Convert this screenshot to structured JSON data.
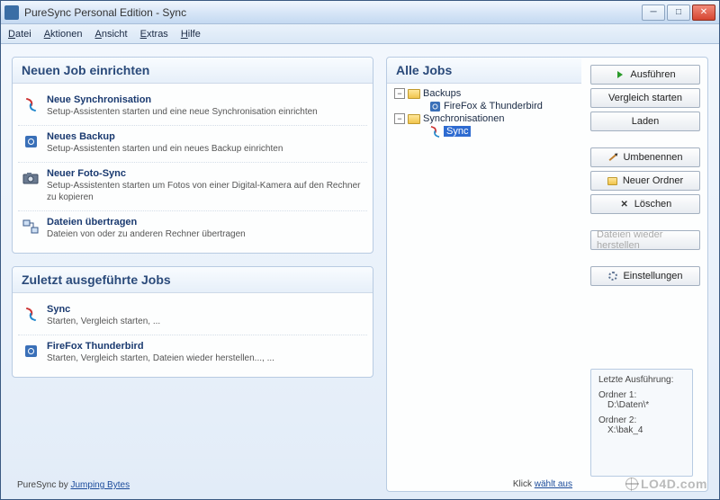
{
  "window": {
    "title": "PureSync Personal Edition  -  Sync"
  },
  "menu": {
    "file": "Datei",
    "actions": "Aktionen",
    "view": "Ansicht",
    "extras": "Extras",
    "help": "Hilfe"
  },
  "panels": {
    "newjob": {
      "header": "Neuen Job einrichten",
      "items": [
        {
          "title": "Neue Synchronisation",
          "desc": "Setup-Assistenten starten und eine neue Synchronisation einrichten",
          "icon": "sync-icon"
        },
        {
          "title": "Neues Backup",
          "desc": "Setup-Assistenten starten und ein neues Backup einrichten",
          "icon": "backup-icon"
        },
        {
          "title": "Neuer Foto-Sync",
          "desc": "Setup-Assistenten starten um Fotos von einer Digital-Kamera auf den Rechner zu kopieren",
          "icon": "camera-icon"
        },
        {
          "title": "Dateien übertragen",
          "desc": "Dateien von oder zu anderen Rechner übertragen",
          "icon": "transfer-icon"
        }
      ]
    },
    "recent": {
      "header": "Zuletzt ausgeführte Jobs",
      "items": [
        {
          "title": "Sync",
          "desc": "Starten, Vergleich starten, ...",
          "icon": "sync-icon"
        },
        {
          "title": "FireFox  Thunderbird",
          "desc": "Starten, Vergleich starten, Dateien wieder herstellen..., ...",
          "icon": "backup-icon"
        }
      ]
    },
    "alljobs": {
      "header": "Alle Jobs",
      "tree": {
        "backups": {
          "label": "Backups",
          "child": "FireFox & Thunderbird"
        },
        "syncs": {
          "label": "Synchronisationen",
          "child": "Sync"
        }
      }
    }
  },
  "buttons": {
    "run": "Ausführen",
    "compare": "Vergleich starten",
    "load": "Laden",
    "rename": "Umbenennen",
    "newfolder": "Neuer Ordner",
    "delete": "Löschen",
    "restore": "Dateien wieder herstellen",
    "settings": "Einstellungen"
  },
  "info": {
    "lastrun_label": "Letzte Ausführung:",
    "folder1_label": "Ordner 1:",
    "folder1_path": "D:\\Daten\\*",
    "folder2_label": "Ordner 2:",
    "folder2_path": "X:\\bak_4"
  },
  "footer": {
    "left_prefix": "PureSync by ",
    "left_link": "Jumping Bytes",
    "right_prefix": "Klick ",
    "right_link": "wählt aus"
  },
  "watermark": "LO4D.com"
}
